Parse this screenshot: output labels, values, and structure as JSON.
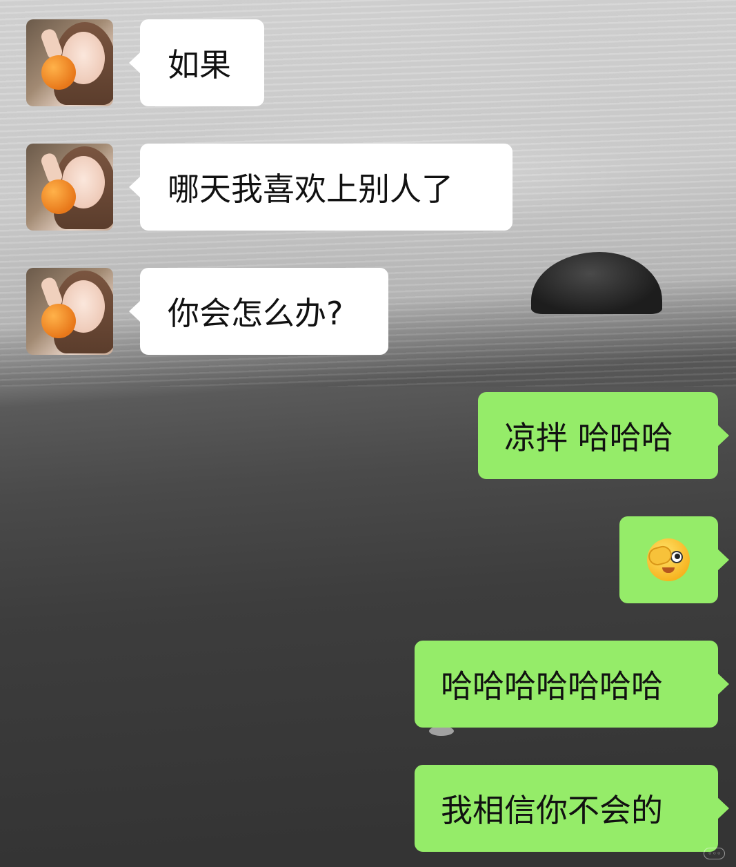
{
  "chat": {
    "messages": [
      {
        "side": "left",
        "text": "如果"
      },
      {
        "side": "left",
        "text": "哪天我喜欢上别人了"
      },
      {
        "side": "left",
        "text": "你会怎么办?"
      },
      {
        "side": "right",
        "text": "凉拌 哈哈哈"
      },
      {
        "side": "right",
        "emoji": "covering-eye-face-emoji"
      },
      {
        "side": "right",
        "text": "哈哈哈哈哈哈哈"
      },
      {
        "side": "right",
        "text": "我相信你不会的"
      }
    ]
  },
  "colors": {
    "incoming_bubble": "#ffffff",
    "outgoing_bubble": "#95ec69"
  }
}
